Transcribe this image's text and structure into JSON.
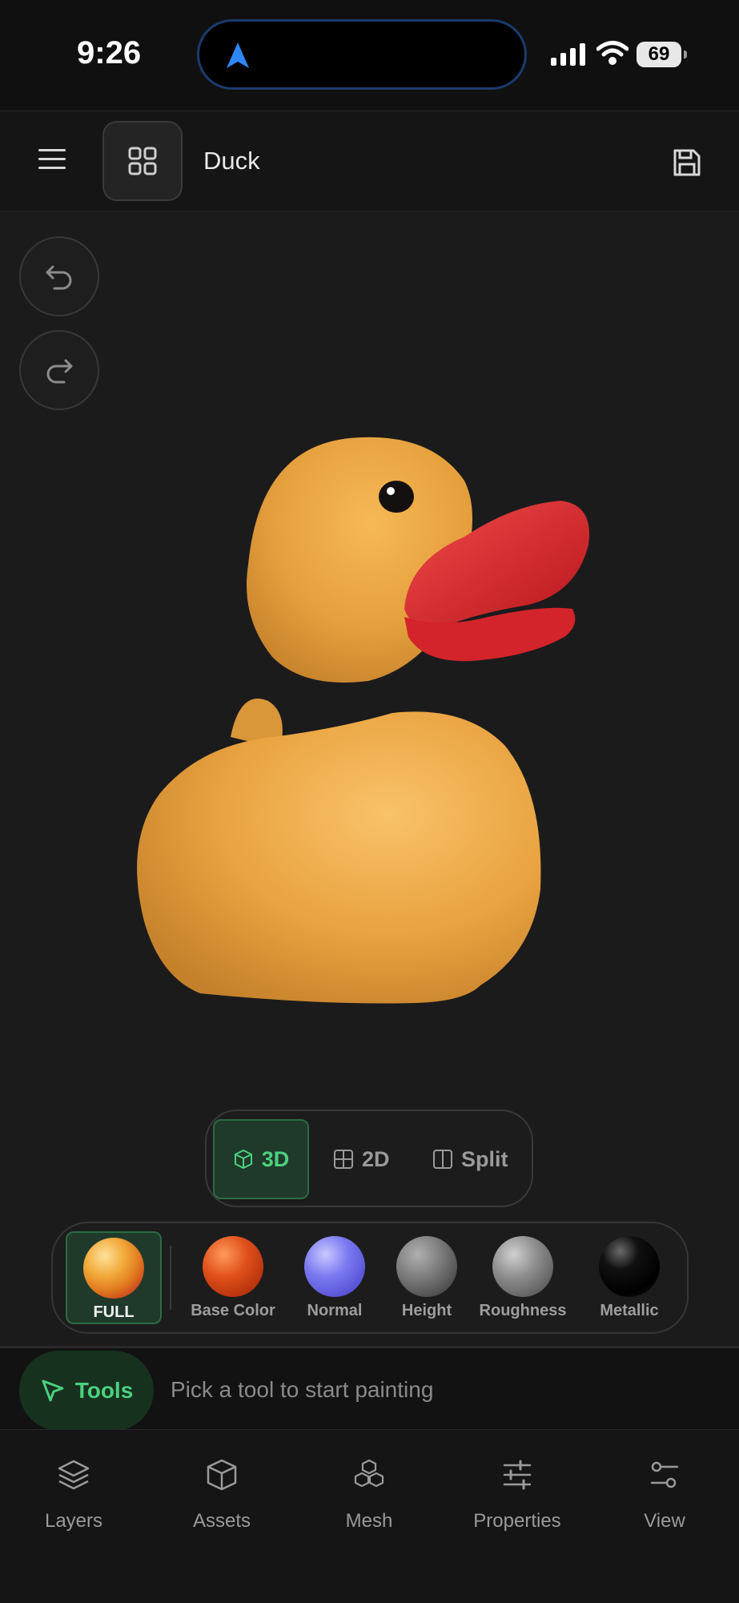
{
  "status_bar": {
    "time": "9:26",
    "battery": "69"
  },
  "toolbar": {
    "project_title": "Duck"
  },
  "view_modes": [
    {
      "label": "3D",
      "icon": "cube-icon",
      "active": true
    },
    {
      "label": "2D",
      "icon": "grid-icon",
      "active": false
    },
    {
      "label": "Split",
      "icon": "split-icon",
      "active": false
    }
  ],
  "channels": [
    {
      "label": "FULL",
      "active": true
    },
    {
      "label": "Base Color",
      "active": false
    },
    {
      "label": "Normal",
      "active": false
    },
    {
      "label": "Height",
      "active": false
    },
    {
      "label": "Roughness",
      "active": false
    },
    {
      "label": "Metallic",
      "active": false
    }
  ],
  "tools": {
    "label": "Tools",
    "hint": "Pick a tool to start painting"
  },
  "bottom_nav": [
    {
      "label": "Layers",
      "icon": "layers-icon"
    },
    {
      "label": "Assets",
      "icon": "box-icon"
    },
    {
      "label": "Mesh",
      "icon": "cubes-icon"
    },
    {
      "label": "Properties",
      "icon": "sliders-icon"
    },
    {
      "label": "View",
      "icon": "view-settings-icon"
    }
  ],
  "colors": {
    "accent_green": "#4cd07f",
    "background": "#1b1b1c",
    "duck_body": "#e8a23a",
    "duck_beak": "#e2262c"
  }
}
